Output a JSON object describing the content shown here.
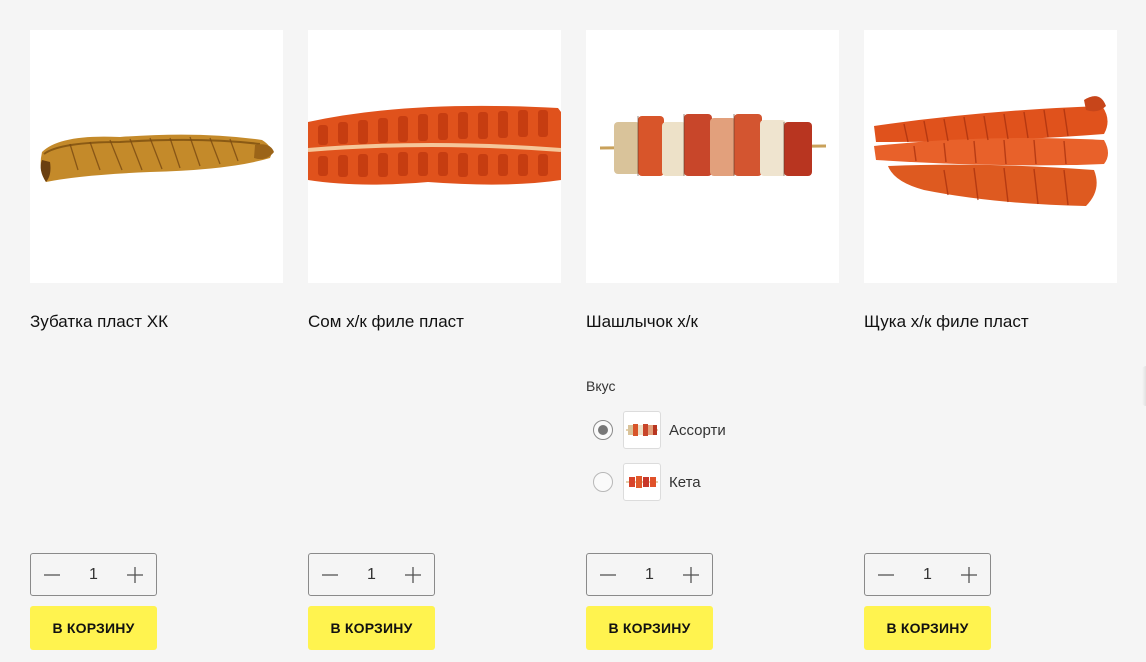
{
  "products": [
    {
      "title": "Зубатка пласт ХК",
      "image": "smoked-catfish-fillet-image",
      "quantity": "1",
      "buy_label": "В КОРЗИНУ"
    },
    {
      "title": "Сом х/к филе пласт",
      "image": "smoked-som-fillet-image",
      "quantity": "1",
      "buy_label": "В КОРЗИНУ"
    },
    {
      "title": "Шашлычок х/к",
      "image": "fish-skewer-image",
      "quantity": "1",
      "buy_label": "В КОРЗИНУ",
      "option_group": {
        "label": "Вкус",
        "options": [
          {
            "label": "Ассорти",
            "selected": true,
            "image": "assorted-skewer-thumb"
          },
          {
            "label": "Кета",
            "selected": false,
            "image": "keta-skewer-thumb"
          }
        ]
      }
    },
    {
      "title": "Щука х/к филе пласт",
      "image": "smoked-pike-fillet-image",
      "quantity": "1",
      "buy_label": "В КОРЗИНУ"
    }
  ],
  "colors": {
    "page_bg": "#f5f5f5",
    "button_bg": "#fff34f",
    "fish_orange": "#e0521c",
    "fish_gold": "#c68a25"
  },
  "icons": {
    "decrement": "minus-icon",
    "increment": "plus-icon"
  }
}
